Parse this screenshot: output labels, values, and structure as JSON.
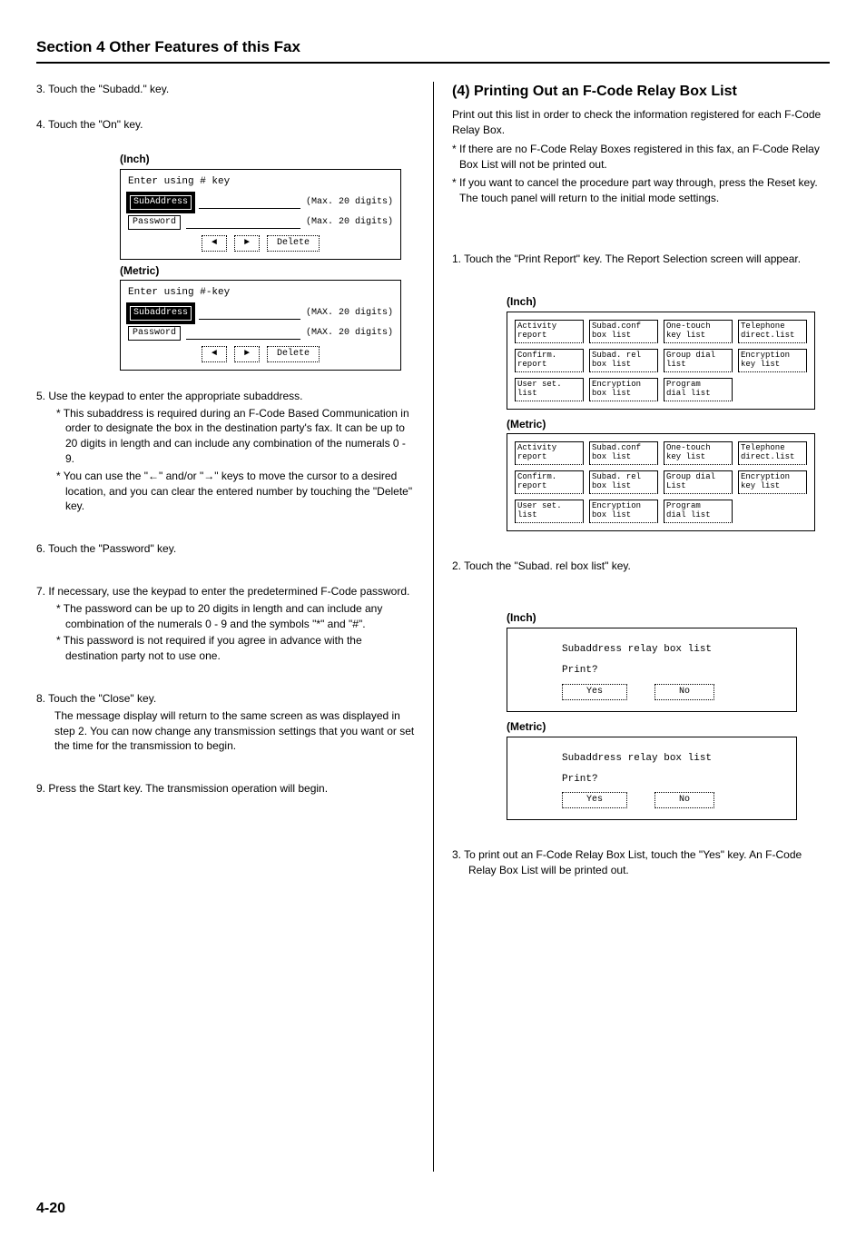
{
  "header": {
    "section_title": "Section 4 Other Features of this Fax"
  },
  "left": {
    "step3": "3. Touch the \"Subadd.\" key.",
    "step4": "4. Touch the \"On\" key.",
    "inch_label": "(Inch)",
    "metric_label": "(Metric)",
    "screen_inch": {
      "line1": "Enter using # key",
      "subaddress": "SubAddress",
      "password": "Password",
      "max20": "(Max. 20 digits)",
      "delete": "Delete"
    },
    "screen_metric": {
      "line1": "Enter using #-key",
      "subaddress": "Subaddress",
      "password": "Password",
      "max20": "(MAX. 20 digits)",
      "delete": "Delete"
    },
    "step5": "5. Use the keypad to enter the appropriate subaddress.",
    "step5_sub1": "* This subaddress is required during an F-Code Based Communication in order to designate the box in the destination party's fax. It can be up to 20 digits in length and can include any combination of the numerals 0 - 9.",
    "step5_sub2": "* You can use the \"←\" and/or \"→\" keys to move the cursor to a desired location, and you can clear the entered number by touching the \"Delete\" key.",
    "step6": "6. Touch the \"Password\" key.",
    "step7": "7. If necessary, use the keypad to enter the predetermined F-Code password.",
    "step7_sub1": "* The password can be up to 20 digits in length and can include any combination of the numerals 0 - 9 and the symbols \"*\" and \"#\".",
    "step7_sub2": "* This password is not required if you agree in advance with the destination party not to use one.",
    "step8": "8. Touch the \"Close\" key.",
    "step8_sub": "The message display will return to the same screen as was displayed in step 2. You can now change any transmission settings that you want or set the time for the transmission to begin.",
    "step9": "9. Press the Start key. The transmission operation will begin."
  },
  "right": {
    "heading": "(4) Printing Out an F-Code Relay Box List",
    "intro": "Print out this list in order to check the information registered for each F-Code Relay Box.",
    "note1": "* If there are no F-Code Relay Boxes registered in this fax, an F-Code Relay Box List will not be printed out.",
    "note2": "* If you want to cancel the procedure part way through, press the Reset key. The touch panel will return to the initial mode settings.",
    "step1": "1. Touch the \"Print Report\" key. The Report Selection screen will appear.",
    "inch_label": "(Inch)",
    "metric_label": "(Metric)",
    "reports_inch": [
      "Activity\nreport",
      "Subad.conf\nbox list",
      "One-touch\nkey list",
      "Telephone\ndirect.list",
      "Confirm.\nreport",
      "Subad. rel\nbox list",
      "Group dial\nlist",
      "Encryption\nkey list",
      "User set.\nlist",
      "Encryption\nbox list",
      "Program\ndial list",
      ""
    ],
    "reports_metric": [
      "Activity\nreport",
      "Subad.conf\nbox list",
      "One-touch\nkey list",
      "Telephone\ndirect.list",
      "Confirm.\nreport",
      "Subad. rel\nbox list",
      "Group dial\nList",
      "Encryption\nkey list",
      "User set.\nlist",
      "Encryption\nbox list",
      "Program\ndial list",
      ""
    ],
    "step2": "2. Touch the \"Subad. rel box list\" key.",
    "print_title": "Subaddress relay box list",
    "print_q": "Print?",
    "yes": "Yes",
    "no": "No",
    "step3": "3. To print out an F-Code Relay Box List, touch the \"Yes\" key. An F-Code Relay Box List will be printed out."
  },
  "footer": {
    "page": "4-20"
  }
}
